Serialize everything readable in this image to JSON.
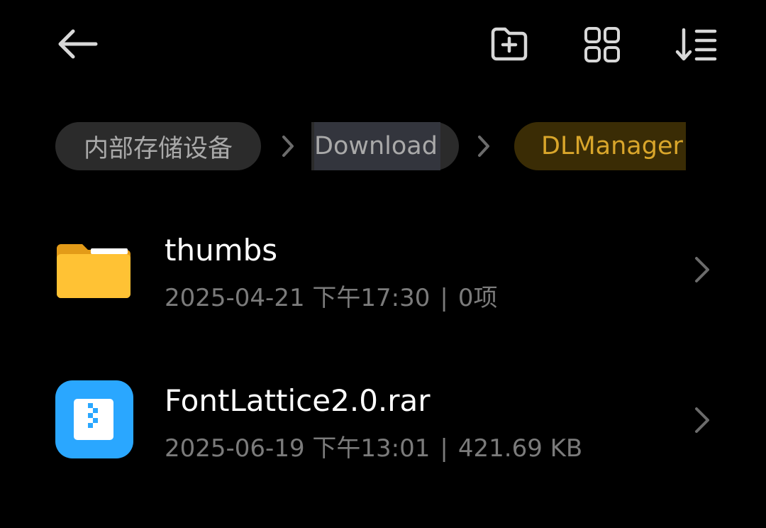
{
  "toolbar": {
    "back_icon": "arrow-left-icon",
    "new_folder_icon": "folder-plus-icon",
    "view_icon": "grid-view-icon",
    "sort_icon": "sort-icon"
  },
  "breadcrumb": {
    "root": "内部存储设备",
    "middle": "Download",
    "current": "DLManager"
  },
  "files": [
    {
      "name": "thumbs",
      "date": "2025-04-21 下午17:30",
      "separator": "|",
      "detail": "0项",
      "icon": "folder-icon"
    },
    {
      "name": "FontLattice2.0.rar",
      "date": "2025-06-19 下午13:01",
      "separator": "|",
      "detail": "421.69 KB",
      "icon": "archive-icon"
    }
  ],
  "colors": {
    "background": "#000000",
    "accent": "#d9a62b",
    "folder": "#ffc234",
    "archive": "#2aa7ff"
  }
}
